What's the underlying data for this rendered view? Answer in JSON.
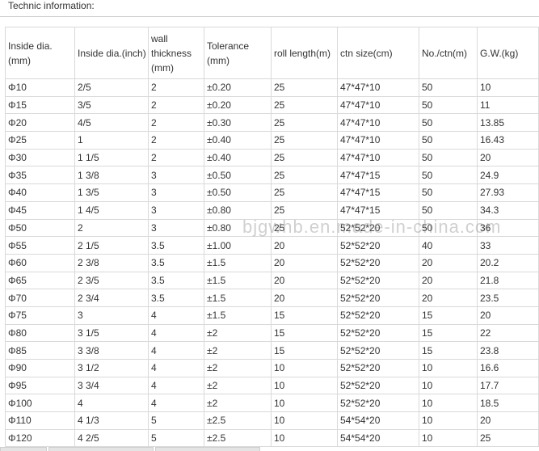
{
  "heading": "Technic information:",
  "watermark": "bjgwhb.en.made-in-china.com",
  "table": {
    "headers": [
      "Inside dia.\n(mm)",
      "Inside dia.(inch)",
      "wall thickness (mm)",
      "Tolerance (mm)",
      "roll length(m)",
      "ctn size(cm)",
      "No./ctn(m)",
      "G.W.(kg)"
    ],
    "rows": [
      [
        "Φ10",
        "2/5",
        "2",
        "±0.20",
        "25",
        "47*47*10",
        "50",
        "10"
      ],
      [
        "Φ15",
        "3/5",
        "2",
        "±0.20",
        "25",
        "47*47*10",
        "50",
        "11"
      ],
      [
        "Φ20",
        "4/5",
        "2",
        "±0.30",
        "25",
        "47*47*10",
        "50",
        "13.85"
      ],
      [
        "Φ25",
        "1",
        "2",
        "±0.40",
        "25",
        "47*47*10",
        "50",
        "16.43"
      ],
      [
        "Φ30",
        "1 1/5",
        "2",
        "±0.40",
        "25",
        "47*47*10",
        "50",
        "20"
      ],
      [
        "Φ35",
        "1 3/8",
        "3",
        "±0.50",
        "25",
        "47*47*15",
        "50",
        "24.9"
      ],
      [
        "Φ40",
        "1 3/5",
        "3",
        "±0.50",
        "25",
        "47*47*15",
        "50",
        "27.93"
      ],
      [
        "Φ45",
        "1 4/5",
        "3",
        "±0.80",
        "25",
        "47*47*15",
        "50",
        "34.3"
      ],
      [
        "Φ50",
        "2",
        "3",
        "±0.80",
        "25",
        "52*52*20",
        "50",
        "36"
      ],
      [
        "Φ55",
        "2 1/5",
        "3.5",
        "±1.00",
        "20",
        "52*52*20",
        "40",
        "33"
      ],
      [
        "Φ60",
        "2 3/8",
        "3.5",
        "±1.5",
        "20",
        "52*52*20",
        "20",
        "20.2"
      ],
      [
        "Φ65",
        "2 3/5",
        "3.5",
        "±1.5",
        "20",
        "52*52*20",
        "20",
        "21.8"
      ],
      [
        "Φ70",
        "2 3/4",
        "3.5",
        "±1.5",
        "20",
        "52*52*20",
        "20",
        "23.5"
      ],
      [
        "Φ75",
        "3",
        "4",
        "±1.5",
        "15",
        "52*52*20",
        "15",
        "20"
      ],
      [
        "Φ80",
        "3 1/5",
        "4",
        "±2",
        "15",
        "52*52*20",
        "15",
        "22"
      ],
      [
        "Φ85",
        "3 3/8",
        "4",
        "±2",
        "15",
        "52*52*20",
        "15",
        "23.8"
      ],
      [
        "Φ90",
        "3 1/2",
        "4",
        "±2",
        "10",
        "52*52*20",
        "10",
        "16.6"
      ],
      [
        "Φ95",
        "3 3/4",
        "4",
        "±2",
        "10",
        "52*52*20",
        "10",
        "17.7"
      ],
      [
        "Φ100",
        "4",
        "4",
        "±2",
        "10",
        "52*52*20",
        "10",
        "18.5"
      ],
      [
        "Φ110",
        "4 1/3",
        "5",
        "±2.5",
        "10",
        "54*54*20",
        "10",
        "20"
      ],
      [
        "Φ120",
        "4 2/5",
        "5",
        "±2.5",
        "10",
        "54*54*20",
        "10",
        "25"
      ]
    ]
  }
}
